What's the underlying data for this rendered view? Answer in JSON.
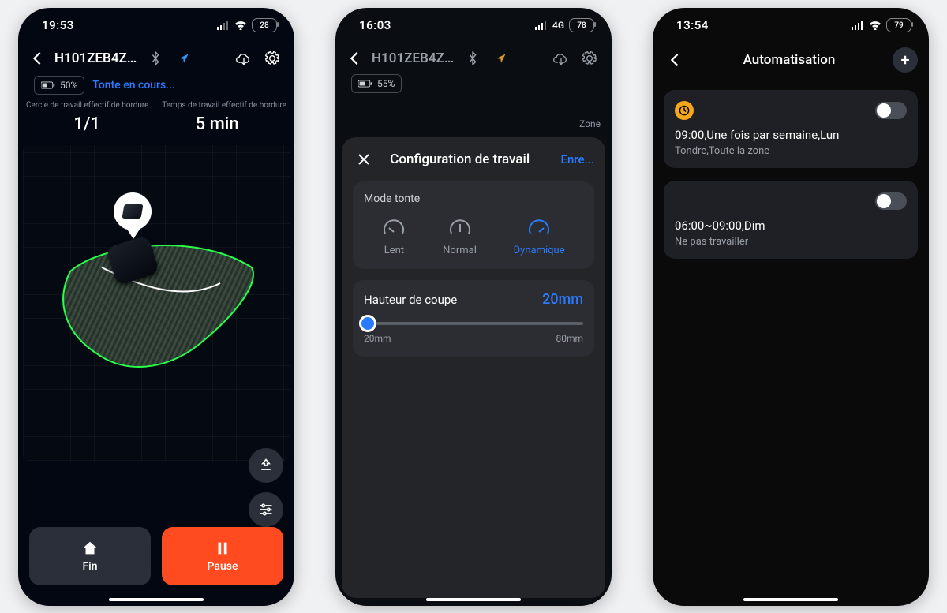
{
  "phone1": {
    "status": {
      "time": "19:53",
      "battery": "28"
    },
    "header": {
      "device": "H101ZEB4ZF2P..."
    },
    "mower_battery": "50%",
    "mowing_status": "Tonte en cours...",
    "stats": {
      "label_left": "Cercle de travail effectif de bordure",
      "label_right": "Temps de travail effectif de bordure",
      "value_left": "1/1",
      "value_right": "5 min"
    },
    "actions": {
      "end": "Fin",
      "pause": "Pause"
    }
  },
  "phone2": {
    "status": {
      "time": "16:03",
      "net": "4G",
      "battery": "78"
    },
    "header": {
      "device": "H101ZEB4ZF2P..."
    },
    "mower_battery": "55%",
    "zone_label": "Zone",
    "sheet": {
      "title": "Configuration de travail",
      "save": "Enre...",
      "mode_title": "Mode tonte",
      "modes": {
        "slow": "Lent",
        "normal": "Normal",
        "dynamic": "Dynamique"
      },
      "cut": {
        "label": "Hauteur de coupe",
        "value": "20mm",
        "min": "20mm",
        "max": "80mm"
      }
    }
  },
  "phone3": {
    "status": {
      "time": "13:54",
      "battery": "79"
    },
    "title": "Automatisation",
    "items": [
      {
        "line1": "09:00,Une fois par semaine,Lun",
        "line2": "Tondre,Toute la zone"
      },
      {
        "line1": "06:00~09:00,Dim",
        "line2": "Ne pas travailler"
      }
    ]
  }
}
